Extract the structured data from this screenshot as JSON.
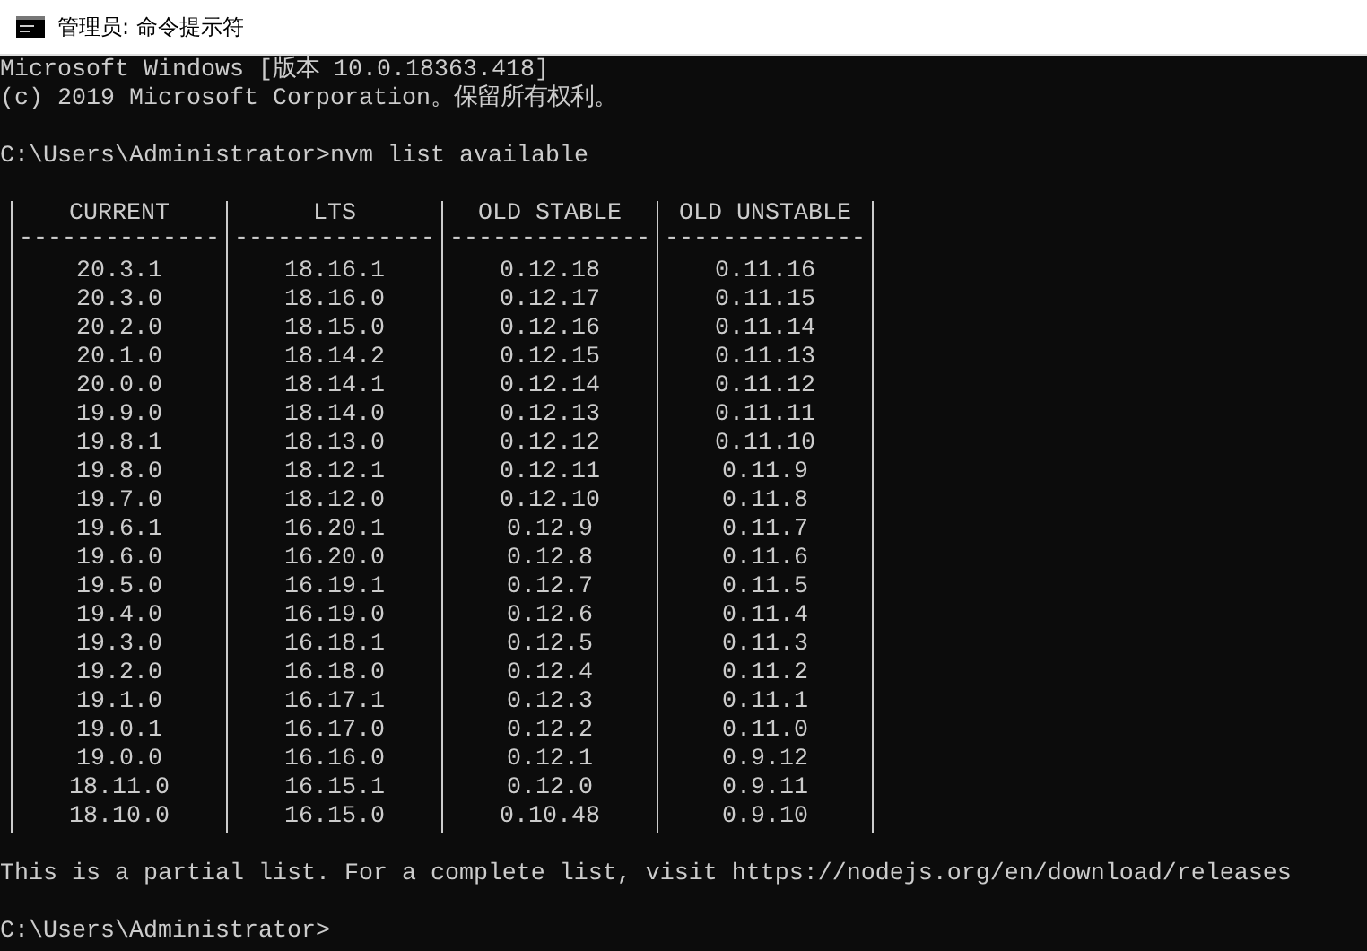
{
  "window": {
    "title": "管理员: 命令提示符"
  },
  "console": {
    "banner": [
      "Microsoft Windows [版本 10.0.18363.418]",
      "(c) 2019 Microsoft Corporation。保留所有权利。"
    ],
    "command_prompt": "C:\\Users\\Administrator>",
    "command": "nvm list available",
    "table": {
      "columns": [
        {
          "header": "CURRENT",
          "rule": "--------------"
        },
        {
          "header": "LTS",
          "rule": "--------------"
        },
        {
          "header": "OLD STABLE",
          "rule": "--------------"
        },
        {
          "header": "OLD UNSTABLE",
          "rule": "--------------"
        }
      ],
      "rows": [
        [
          "20.3.1",
          "18.16.1",
          "0.12.18",
          "0.11.16"
        ],
        [
          "20.3.0",
          "18.16.0",
          "0.12.17",
          "0.11.15"
        ],
        [
          "20.2.0",
          "18.15.0",
          "0.12.16",
          "0.11.14"
        ],
        [
          "20.1.0",
          "18.14.2",
          "0.12.15",
          "0.11.13"
        ],
        [
          "20.0.0",
          "18.14.1",
          "0.12.14",
          "0.11.12"
        ],
        [
          "19.9.0",
          "18.14.0",
          "0.12.13",
          "0.11.11"
        ],
        [
          "19.8.1",
          "18.13.0",
          "0.12.12",
          "0.11.10"
        ],
        [
          "19.8.0",
          "18.12.1",
          "0.12.11",
          "0.11.9"
        ],
        [
          "19.7.0",
          "18.12.0",
          "0.12.10",
          "0.11.8"
        ],
        [
          "19.6.1",
          "16.20.1",
          "0.12.9",
          "0.11.7"
        ],
        [
          "19.6.0",
          "16.20.0",
          "0.12.8",
          "0.11.6"
        ],
        [
          "19.5.0",
          "16.19.1",
          "0.12.7",
          "0.11.5"
        ],
        [
          "19.4.0",
          "16.19.0",
          "0.12.6",
          "0.11.4"
        ],
        [
          "19.3.0",
          "16.18.1",
          "0.12.5",
          "0.11.3"
        ],
        [
          "19.2.0",
          "16.18.0",
          "0.12.4",
          "0.11.2"
        ],
        [
          "19.1.0",
          "16.17.1",
          "0.12.3",
          "0.11.1"
        ],
        [
          "19.0.1",
          "16.17.0",
          "0.12.2",
          "0.11.0"
        ],
        [
          "19.0.0",
          "16.16.0",
          "0.12.1",
          "0.9.12"
        ],
        [
          "18.11.0",
          "16.15.1",
          "0.12.0",
          "0.9.11"
        ],
        [
          "18.10.0",
          "16.15.0",
          "0.10.48",
          "0.9.10"
        ]
      ]
    },
    "note": "This is a partial list. For a complete list, visit https://nodejs.org/en/download/releases",
    "final_prompt": "C:\\Users\\Administrator>"
  }
}
